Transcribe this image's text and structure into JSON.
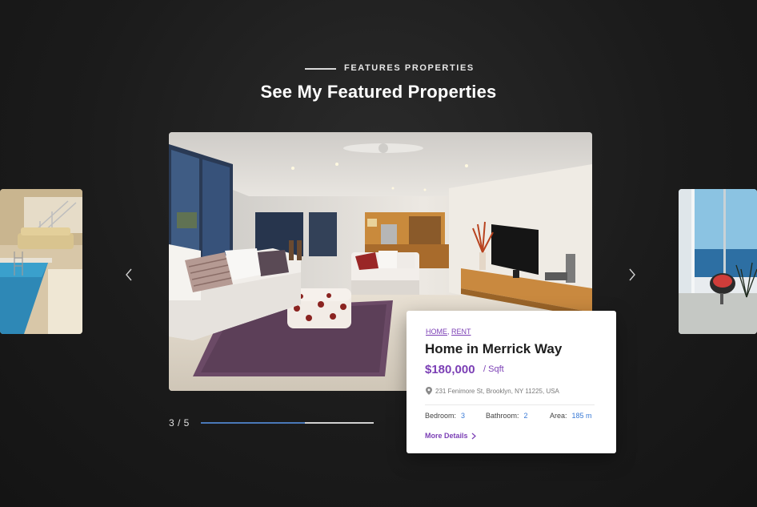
{
  "section": {
    "kicker": "FEATURES PROPERTIES",
    "title": "See My Featured Properties"
  },
  "slider": {
    "counter": "3 / 5",
    "progress": 0.6,
    "prev_icon": "chevron-left-icon",
    "next_icon": "chevron-right-icon"
  },
  "property": {
    "tags": [
      "HOME",
      "RENT"
    ],
    "tag_separator": ",",
    "title": "Home in Merrick Way",
    "price": "$180,000",
    "price_unit": "/ Sqft",
    "address": "231 Fenimore St, Brooklyn, NY 11225, USA",
    "bedroom_label": "Bedroom:",
    "bedroom_value": "3",
    "bathroom_label": "Bathroom:",
    "bathroom_value": "2",
    "area_label": "Area:",
    "area_value": "185 m",
    "more_label": "More Details"
  },
  "colors": {
    "accent": "#7b3fb5",
    "link_blue": "#3b7bd6",
    "progress": "#4a78b8"
  }
}
